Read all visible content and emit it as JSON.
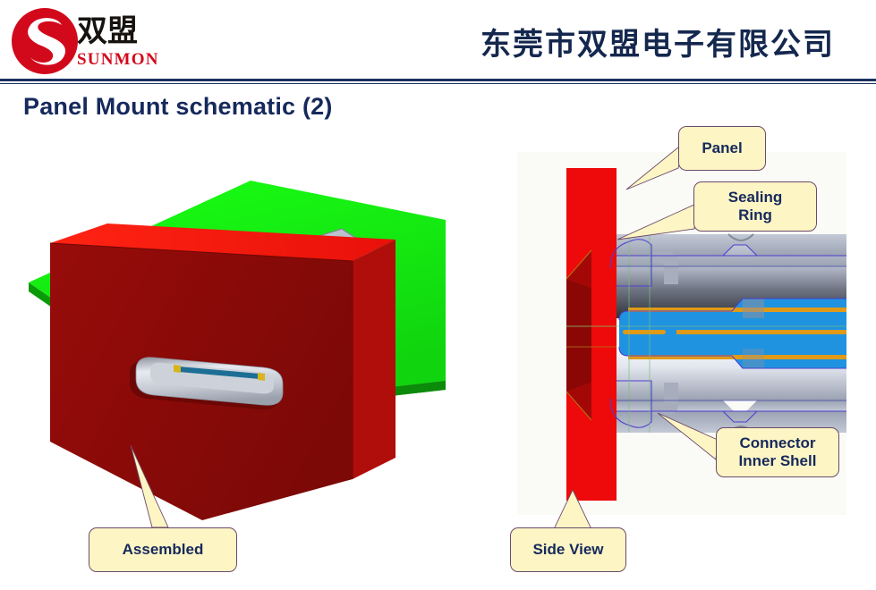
{
  "header": {
    "logo": {
      "mark_name": "sunmon-s-logo",
      "cn_text": "双盟",
      "en_text": "SUNMON",
      "mark_color": "#d2091b"
    },
    "company_name": "东莞市双盟电子有限公司",
    "divider_color": "#1b3260"
  },
  "title": "Panel Mount schematic (2)",
  "figures": {
    "left": {
      "name": "assembled-3d-view",
      "description": "3D render of USB connector mounted through a red panel on a green PCB",
      "colors": {
        "pcb_green": "#15e112",
        "pcb_green_edge": "#0a9a08",
        "panel_red_face": "#8f0b09",
        "panel_red_top": "#f8190b",
        "connector_silver": "#b9bfca",
        "connector_blue": "#1e7ed8",
        "slot_interior": "#c8ccd4"
      }
    },
    "right": {
      "name": "side-view-cross-section",
      "description": "Cross-section side view of panel mount USB connector with sealing ring",
      "colors": {
        "panel_red": "#ee0a0a",
        "panel_red_dark": "#8b0706",
        "sealing_yellow": "#d6d819",
        "shell_gray": "#a7adbd",
        "shell_light": "#f2f4f8",
        "shell_dark": "#3b3f46",
        "insert_blue": "#1f93e0",
        "contact_gold": "#e09a18",
        "outline_purple": "#4b3fd0",
        "background": "#fafaf7"
      }
    }
  },
  "callouts": [
    {
      "id": "panel",
      "label": "Panel"
    },
    {
      "id": "sealing",
      "label": "Sealing\nRing",
      "line1": "Sealing",
      "line2": "Ring"
    },
    {
      "id": "inner_shell",
      "label": "Connector Inner Shell",
      "line1": "Connector",
      "line2": "Inner Shell"
    },
    {
      "id": "assembled",
      "label": "Assembled"
    },
    {
      "id": "side_view",
      "label": "Side View"
    }
  ],
  "callout_style": {
    "fill": "#fdf5c4",
    "border": "#6b4a6b",
    "text_color": "#16295c"
  }
}
